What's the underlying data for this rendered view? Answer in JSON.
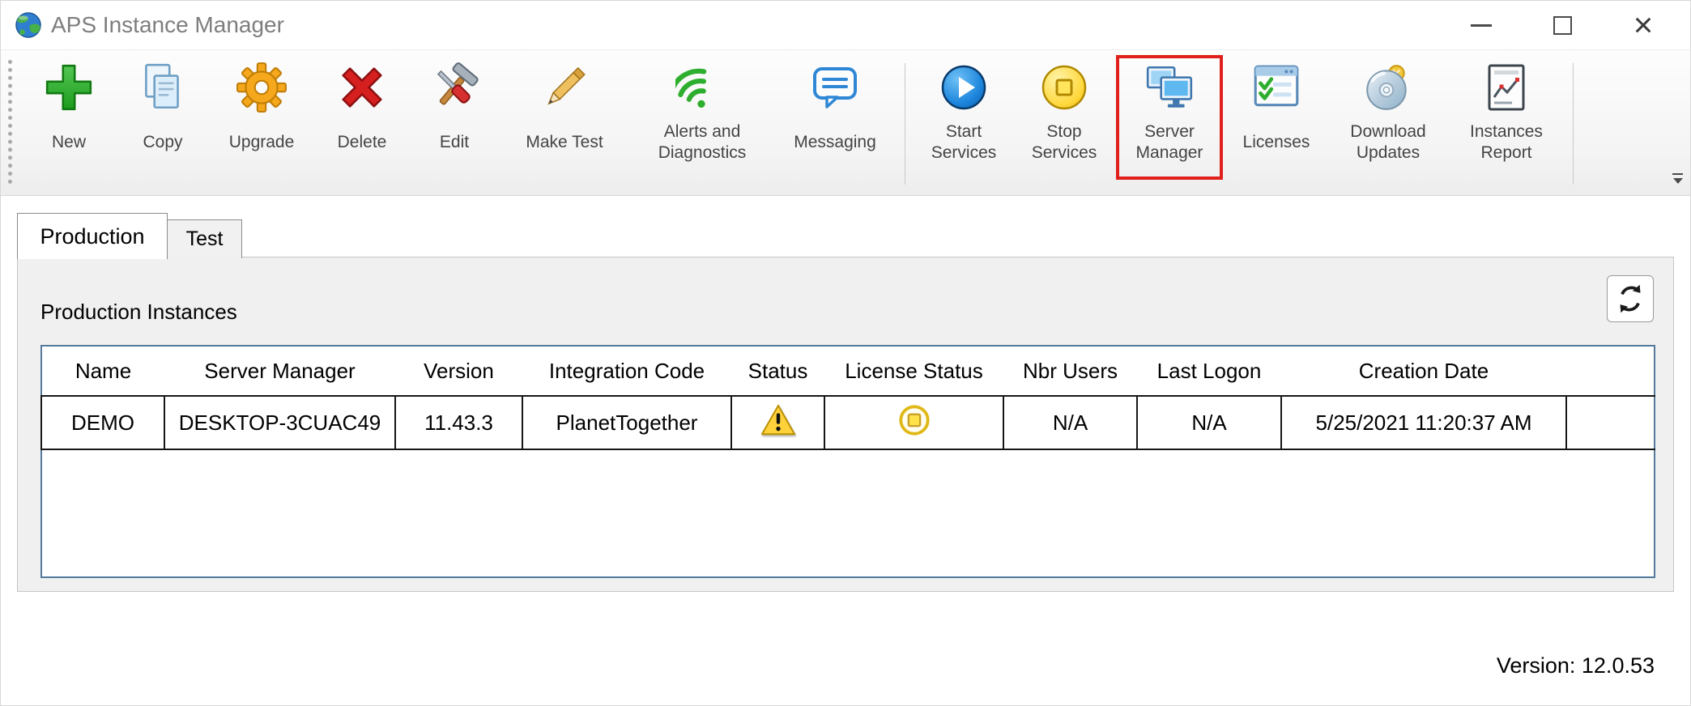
{
  "window": {
    "title": "APS Instance Manager",
    "controls": [
      "minimize",
      "maximize",
      "close"
    ]
  },
  "toolbar": {
    "items": [
      {
        "label": "New",
        "icon": "new-plus-icon"
      },
      {
        "label": "Copy",
        "icon": "copy-icon"
      },
      {
        "label": "Upgrade",
        "icon": "upgrade-gear-icon"
      },
      {
        "label": "Delete",
        "icon": "delete-x-icon"
      },
      {
        "label": "Edit",
        "icon": "edit-tools-icon"
      },
      {
        "label": "Make Test",
        "icon": "make-test-pencil-icon"
      },
      {
        "label": "Alerts and Diagnostics",
        "icon": "alerts-signal-icon"
      },
      {
        "label": "Messaging",
        "icon": "messaging-bubble-icon"
      },
      {
        "label": "Start Services",
        "icon": "start-services-play-icon"
      },
      {
        "label": "Stop Services",
        "icon": "stop-services-icon"
      },
      {
        "label": "Server Manager",
        "icon": "server-manager-icon",
        "highlighted": true
      },
      {
        "label": "Licenses",
        "icon": "licenses-icon"
      },
      {
        "label": "Download Updates",
        "icon": "download-updates-disc-icon"
      },
      {
        "label": "Instances Report",
        "icon": "instances-report-icon"
      }
    ]
  },
  "tabs": [
    {
      "label": "Production",
      "active": true
    },
    {
      "label": "Test",
      "active": false
    }
  ],
  "panel": {
    "title": "Production Instances"
  },
  "table": {
    "columns": [
      "Name",
      "Server Manager",
      "Version",
      "Integration Code",
      "Status",
      "License Status",
      "Nbr Users",
      "Last Logon",
      "Creation Date"
    ],
    "rows": [
      {
        "name": "DEMO",
        "server_manager": "DESKTOP-3CUAC49",
        "version": "11.43.3",
        "integration_code": "PlanetTogether",
        "status_icon": "warning-icon",
        "license_status_icon": "stop-circle-icon",
        "nbr_users": "N/A",
        "last_logon": "N/A",
        "creation_date": "5/25/2021 11:20:37 AM"
      }
    ]
  },
  "footer": {
    "version": "Version: 12.0.53"
  },
  "colors": {
    "highlight_red": "#e0201c",
    "table_border_blue": "#53799b",
    "warning_yellow": "#ffd23c",
    "status_gold": "#e0b816",
    "start_blue": "#1d86dd",
    "signal_green": "#2eae2e"
  }
}
